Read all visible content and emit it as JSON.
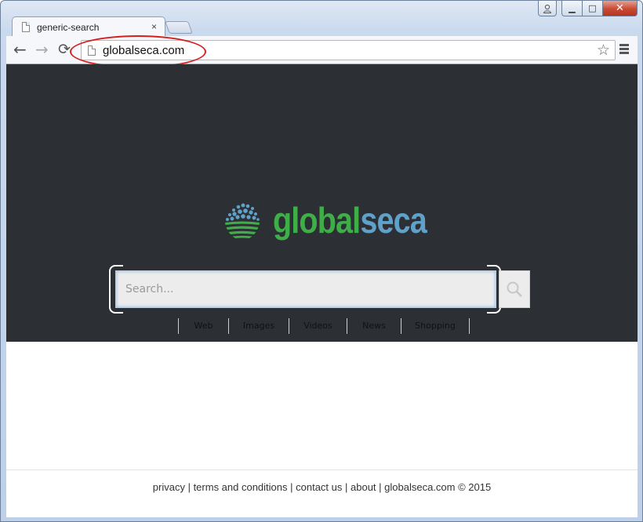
{
  "browser": {
    "tab": {
      "title": "generic-search",
      "close": "×"
    },
    "address_bar": {
      "url": "globalseca.com"
    },
    "nav": {
      "back": "←",
      "forward": "→",
      "reload": "⟳"
    },
    "window_controls": {
      "minimize": "▁",
      "maximize": "□",
      "close": "✕"
    },
    "icons": [
      "page-icon",
      "star-icon",
      "menu-icon",
      "user-icon",
      "search-icon"
    ]
  },
  "logo": {
    "part1": "global",
    "part2": "seca",
    "green": "#3fae49",
    "blue": "#5fa1c9"
  },
  "search": {
    "placeholder": "Search...",
    "tabs": [
      "Web",
      "Images",
      "Videos",
      "News",
      "Shopping"
    ]
  },
  "footer": {
    "links": [
      "privacy",
      "terms and conditions",
      "contact us",
      "about"
    ],
    "separator": " | ",
    "copyright": "globalseca.com © 2015"
  },
  "colors": {
    "hero_bg": "#2c2f34",
    "annotation": "#d42020"
  }
}
